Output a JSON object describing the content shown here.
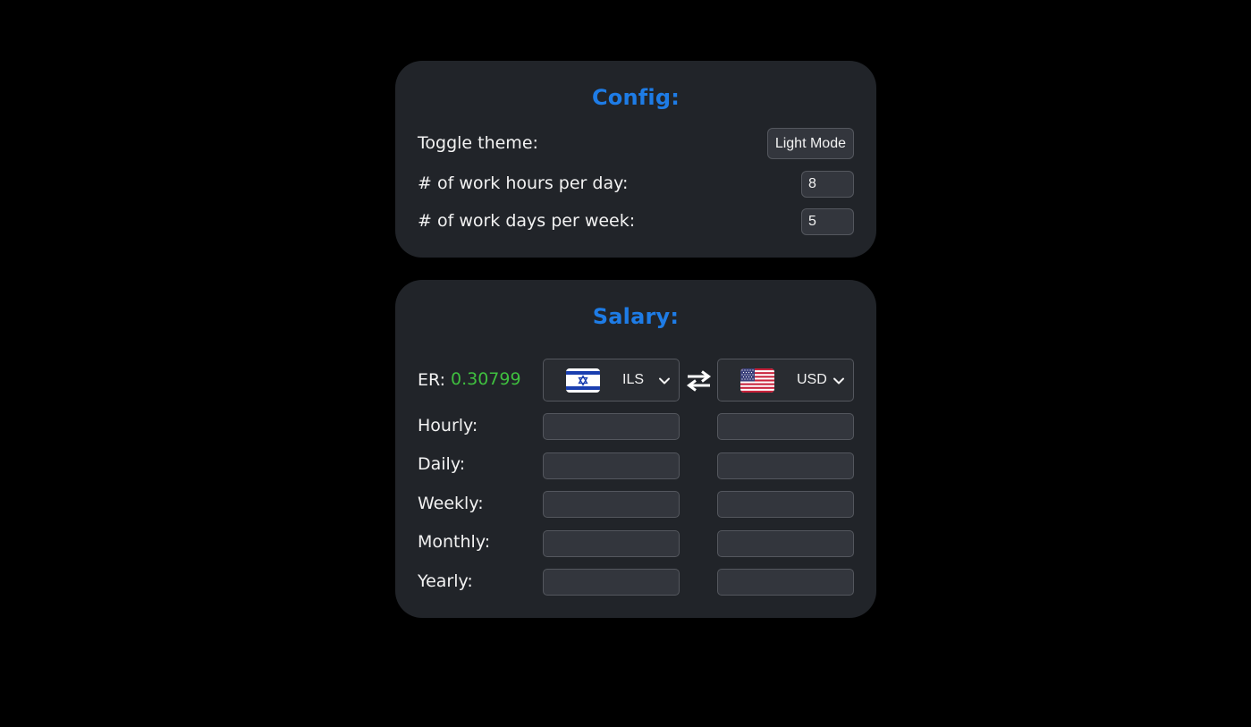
{
  "config": {
    "title": "Config:",
    "toggle_theme_label": "Toggle theme:",
    "theme_button_label": "Light Mode",
    "hours_label": "# of work hours per day:",
    "hours_value": "8",
    "days_label": "# of work days per week:",
    "days_value": "5"
  },
  "salary": {
    "title": "Salary:",
    "er_label": "ER:",
    "er_value": "0.30799",
    "from_currency": {
      "code": "ILS",
      "flag_icon": "israel-flag-icon"
    },
    "to_currency": {
      "code": "USD",
      "flag_icon": "usa-flag-icon"
    },
    "swap_icon": "swap-arrows-icon",
    "rows": [
      {
        "label": "Hourly:",
        "from_value": "",
        "to_value": ""
      },
      {
        "label": "Daily:",
        "from_value": "",
        "to_value": ""
      },
      {
        "label": "Weekly:",
        "from_value": "",
        "to_value": ""
      },
      {
        "label": "Monthly:",
        "from_value": "",
        "to_value": ""
      },
      {
        "label": "Yearly:",
        "from_value": "",
        "to_value": ""
      }
    ]
  },
  "colors": {
    "background": "#000000",
    "card": "#212429",
    "accent": "#1e7ce6",
    "rate": "#3fbf3f",
    "input_bg": "#33363d"
  }
}
